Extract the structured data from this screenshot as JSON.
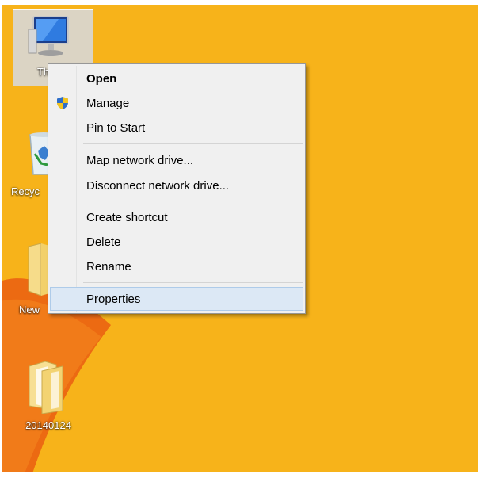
{
  "desktop": {
    "background_color": "#f7b31a",
    "icons": [
      {
        "name": "this-pc",
        "label": "Thi",
        "icon": "computer-icon"
      },
      {
        "name": "recycle-bin",
        "label": "Recyc",
        "icon": "recycle-bin-icon"
      },
      {
        "name": "new-folder",
        "label": "New",
        "icon": "folder-icon"
      },
      {
        "name": "folder-20140124",
        "label": "20140124",
        "icon": "folder-icon"
      }
    ]
  },
  "context_menu": {
    "items": [
      {
        "label": "Open",
        "bold": true
      },
      {
        "label": "Manage",
        "icon": "uac-shield-icon"
      },
      {
        "label": "Pin to Start"
      },
      {
        "label": "Map network drive..."
      },
      {
        "label": "Disconnect network drive..."
      },
      {
        "label": "Create shortcut"
      },
      {
        "label": "Delete"
      },
      {
        "label": "Rename"
      },
      {
        "label": "Properties",
        "highlighted": true
      }
    ]
  }
}
